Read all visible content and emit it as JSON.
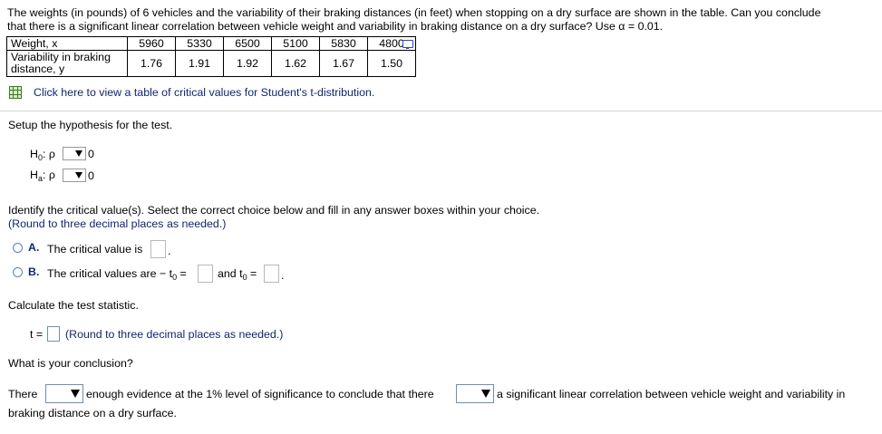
{
  "problem": {
    "line1": "The weights (in pounds) of 6 vehicles and the variability of their braking distances (in feet) when stopping on a dry surface are shown in the table. Can you conclude",
    "line2": "that there is a significant linear correlation between vehicle weight and variability in braking distance on a dry surface? Use α = 0.01."
  },
  "table": {
    "row1_label": "Weight, x",
    "row1_values": [
      "5960",
      "5330",
      "6500",
      "5100",
      "5830",
      "4800"
    ],
    "row2_label_line1": "Variability in braking",
    "row2_label_line2": "distance, y",
    "row2_values": [
      "1.76",
      "1.91",
      "1.92",
      "1.62",
      "1.67",
      "1.50"
    ]
  },
  "critical_link": "Click here to view a table of critical values for Student's t-distribution.",
  "hypothesis": {
    "prompt": "Setup the hypothesis for the test.",
    "h0_label": "H",
    "h0_sub": "0",
    "ha_label": "H",
    "ha_sub": "a",
    "rho": ": ρ",
    "value": "0"
  },
  "critical": {
    "prompt": "Identify the critical value(s). Select the correct choice below and fill in any answer boxes within your choice.",
    "round_note": "(Round to three decimal places as needed.)",
    "option_a_letter": "A.",
    "option_a_text": "The critical value is",
    "option_b_letter": "B.",
    "option_b_text": "The critical values are  − t",
    "option_b_mid": "and t",
    "sub0": "0",
    "equals": "="
  },
  "statistic": {
    "prompt": "Calculate the test statistic.",
    "t_label": "t =",
    "round_note": "(Round to three decimal places as needed.)"
  },
  "conclusion": {
    "prompt": "What is your conclusion?",
    "there": "There",
    "middle": "enough evidence at the 1% level of significance to conclude that there",
    "end": "a significant linear correlation between vehicle weight and variability in",
    "line2": "braking distance on a dry surface."
  }
}
